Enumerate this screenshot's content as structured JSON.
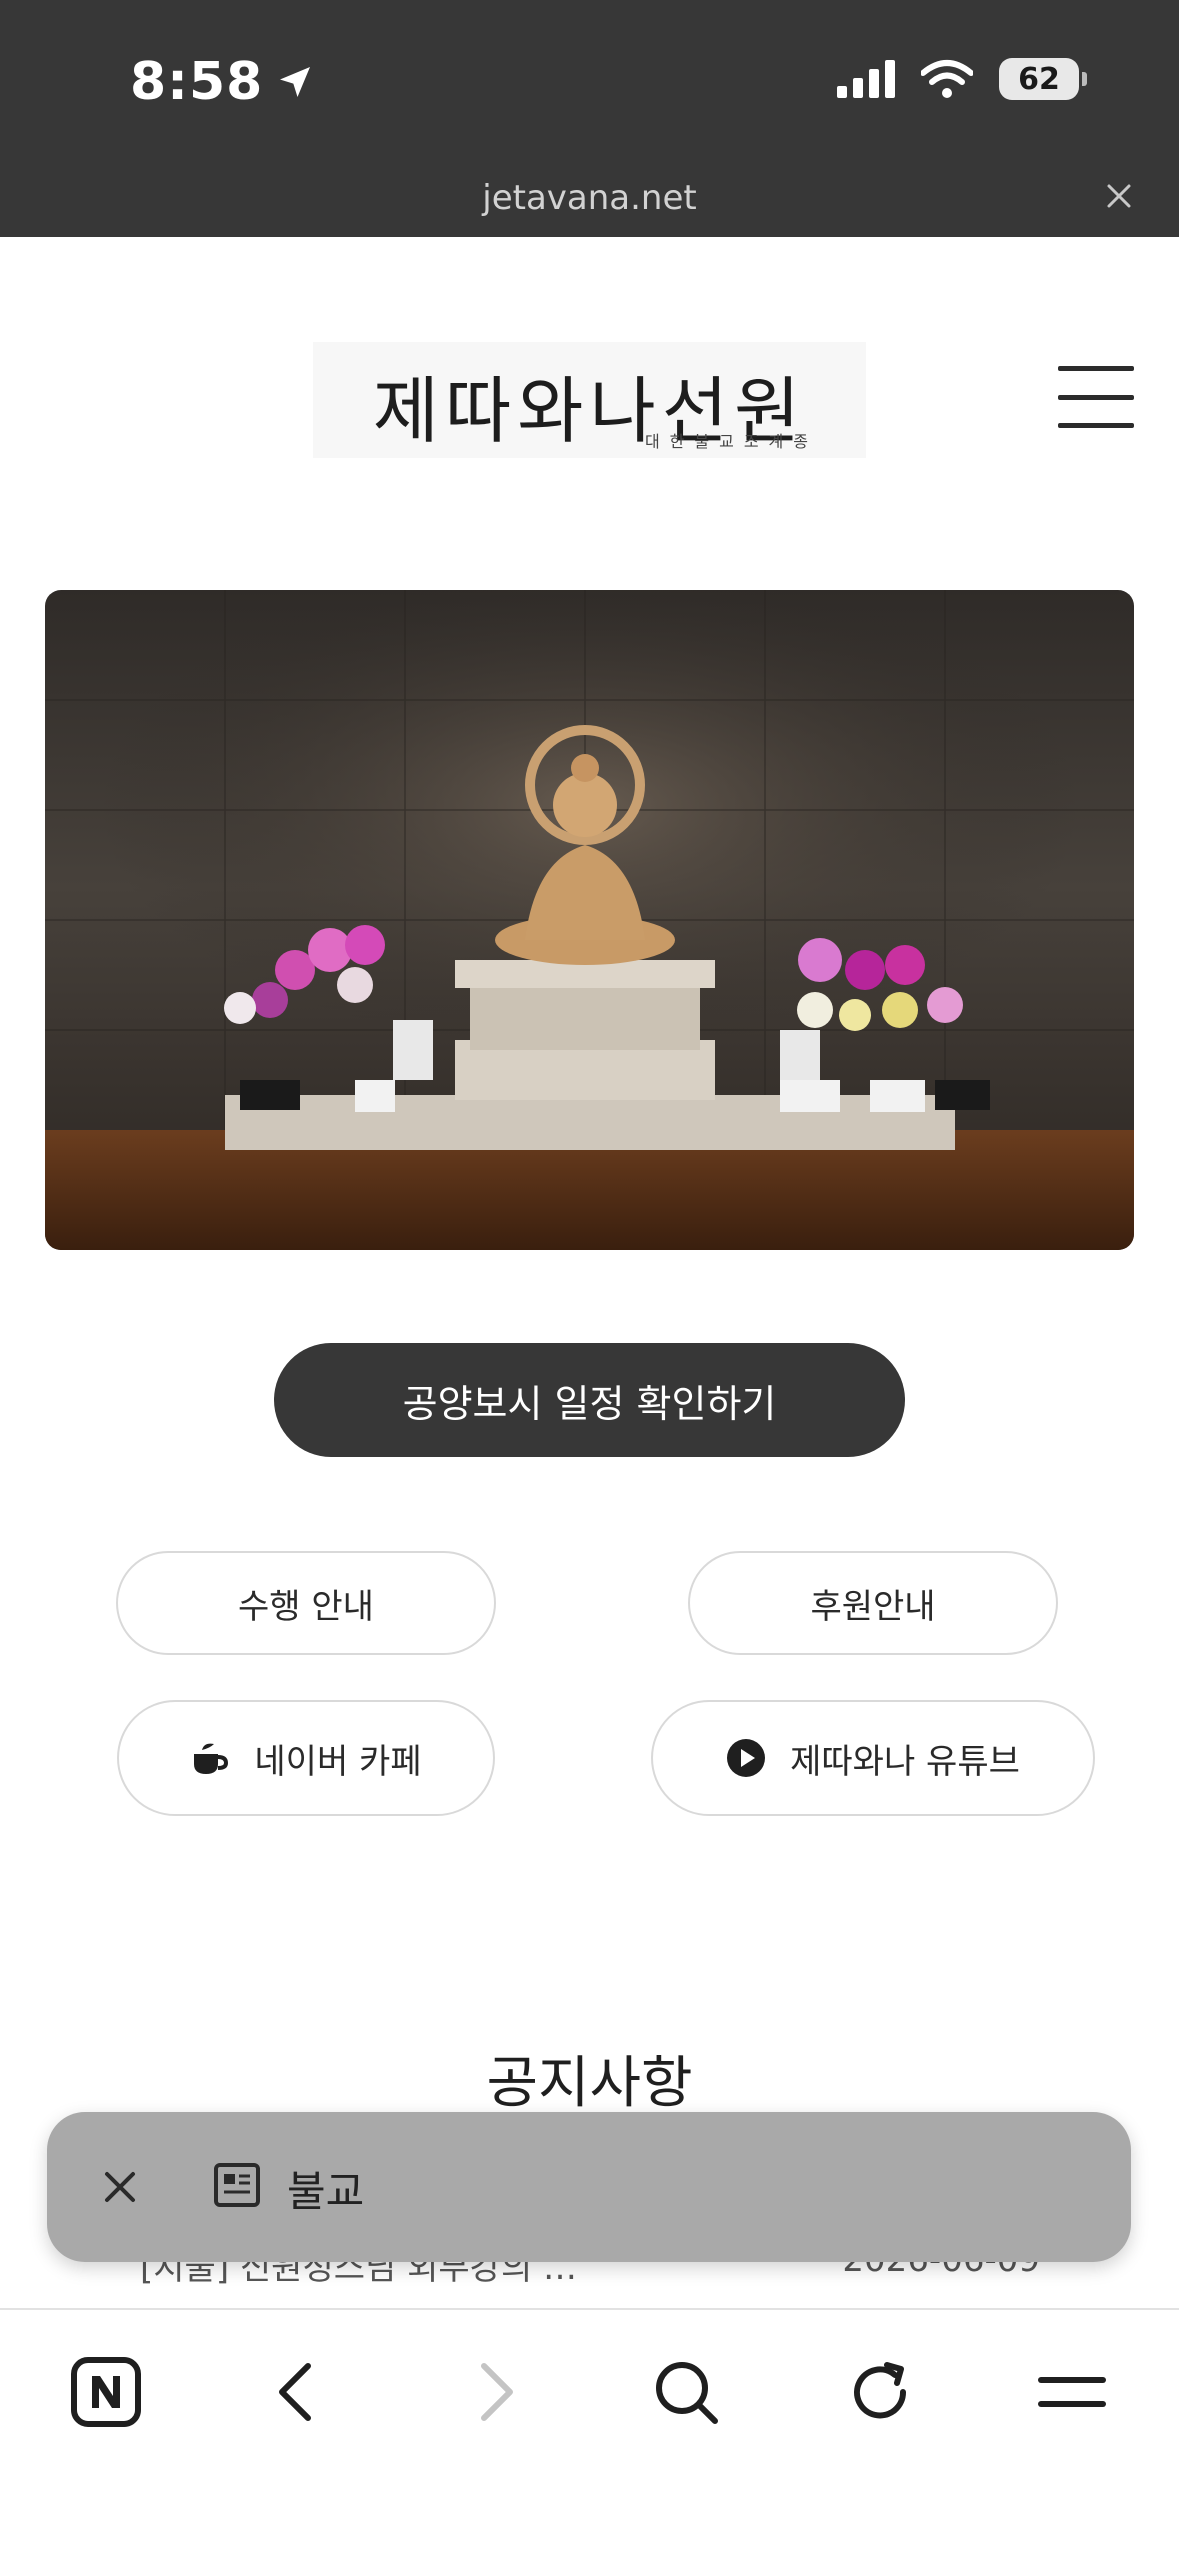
{
  "status_bar": {
    "time": "8:58",
    "battery": "62"
  },
  "browser": {
    "url": "jetavana.net"
  },
  "header": {
    "logo_title": "제따와나선원",
    "logo_subtitle": "대한불교조계종"
  },
  "cta": {
    "label": "공양보시 일정 확인하기"
  },
  "links": {
    "practice": "수행 안내",
    "support": "후원안내",
    "cafe": "네이버 카페",
    "youtube": "제따와나 유튜브"
  },
  "notices": {
    "title": "공지사항",
    "items": [
      {
        "title": "[지물] 신원정스님 외부강의 …",
        "date": "2026-06-09"
      }
    ]
  },
  "floating_bar": {
    "label": "불교"
  },
  "icons": [
    "location-arrow-icon",
    "signal-icon",
    "wifi-icon",
    "battery-icon",
    "close-icon",
    "menu-icon",
    "coffee-icon",
    "play-icon",
    "document-icon",
    "naver-home-icon",
    "back-icon",
    "forward-icon",
    "search-icon",
    "reload-icon",
    "more-menu-icon"
  ],
  "colors": {
    "chrome": "#373737",
    "cta": "#373737",
    "float_bar": "#a9a9a9",
    "pill_border": "#d9d9d9"
  }
}
